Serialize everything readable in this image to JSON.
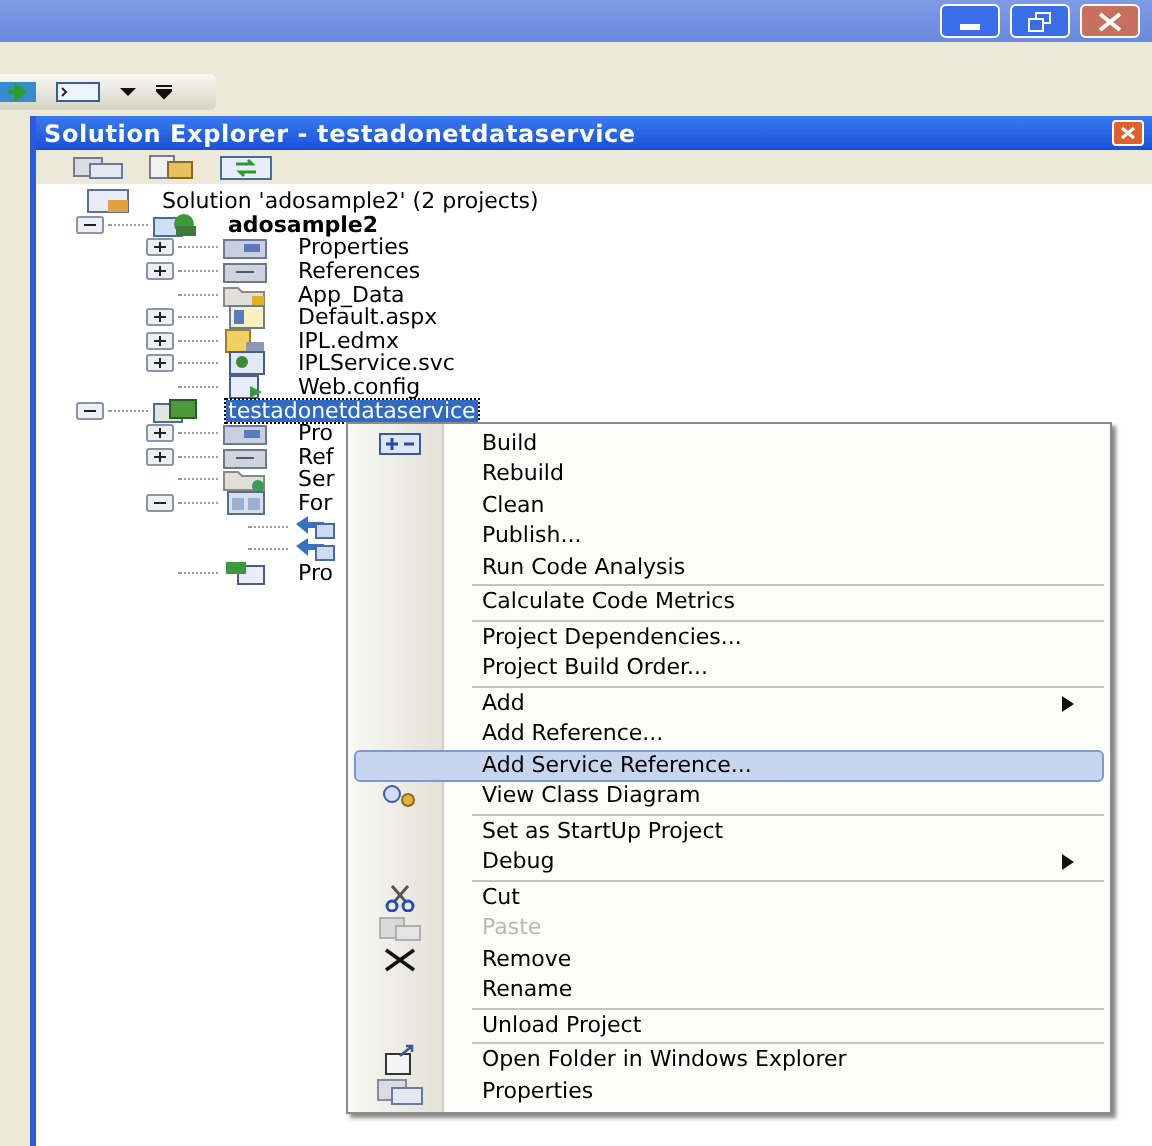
{
  "solution_explorer": {
    "title": "Solution Explorer - testadonetdataservice",
    "tree": [
      {
        "label": "Solution 'adosample2' (2 projects)",
        "kind": "solution",
        "selected": false,
        "children": [
          {
            "label": "adosample2",
            "kind": "web-project",
            "bold": true,
            "expanded": true,
            "selected": false,
            "children": [
              {
                "label": "Properties",
                "kind": "properties",
                "expanded": false,
                "selected": false
              },
              {
                "label": "References",
                "kind": "references",
                "expanded": false,
                "selected": false
              },
              {
                "label": "App_Data",
                "kind": "folder",
                "selected": false
              },
              {
                "label": "Default.aspx",
                "kind": "page",
                "expanded": false,
                "selected": false
              },
              {
                "label": "IPL.edmx",
                "kind": "model",
                "expanded": false,
                "selected": false
              },
              {
                "label": "IPLService.svc",
                "kind": "service",
                "expanded": false,
                "selected": false
              },
              {
                "label": "Web.config",
                "kind": "config",
                "selected": false
              }
            ]
          },
          {
            "label": "testadonetdataservice",
            "kind": "cs-project",
            "bold": false,
            "expanded": true,
            "selected": true,
            "children": [
              {
                "label": "Pro",
                "kind": "properties",
                "expanded": false,
                "selected": false
              },
              {
                "label": "Ref",
                "kind": "references",
                "expanded": false,
                "selected": false
              },
              {
                "label": "Ser",
                "kind": "service-folder",
                "selected": false
              },
              {
                "label": "For",
                "kind": "form",
                "expanded": true,
                "selected": false,
                "children": [
                  {
                    "kind": "form-item"
                  },
                  {
                    "kind": "form-item"
                  }
                ]
              },
              {
                "label": "Pro",
                "kind": "cs-file",
                "selected": false
              }
            ]
          }
        ]
      }
    ]
  },
  "context_menu": {
    "groups": [
      [
        {
          "label": "Build",
          "kind": "build",
          "disabled": false,
          "selected": false,
          "submenu": false
        },
        {
          "label": "Rebuild",
          "kind": "plain",
          "disabled": false,
          "selected": false,
          "submenu": false
        },
        {
          "label": "Clean",
          "kind": "plain",
          "disabled": false,
          "selected": false,
          "submenu": false
        },
        {
          "label": "Publish...",
          "kind": "plain",
          "disabled": false,
          "selected": false,
          "submenu": false
        },
        {
          "label": "Run Code Analysis",
          "kind": "plain",
          "disabled": false,
          "selected": false,
          "submenu": false
        }
      ],
      [
        {
          "label": "Calculate Code Metrics",
          "kind": "plain",
          "disabled": false,
          "selected": false,
          "submenu": false
        }
      ],
      [
        {
          "label": "Project Dependencies...",
          "kind": "plain",
          "disabled": false,
          "selected": false,
          "submenu": false
        },
        {
          "label": "Project Build Order...",
          "kind": "plain",
          "disabled": false,
          "selected": false,
          "submenu": false
        }
      ],
      [
        {
          "label": "Add",
          "kind": "plain",
          "disabled": false,
          "selected": false,
          "submenu": true
        },
        {
          "label": "Add Reference...",
          "kind": "plain",
          "disabled": false,
          "selected": false,
          "submenu": false
        },
        {
          "label": "Add Service Reference...",
          "kind": "plain",
          "disabled": false,
          "selected": true,
          "submenu": false
        },
        {
          "label": "View Class Diagram",
          "kind": "diagram",
          "disabled": false,
          "selected": false,
          "submenu": false
        }
      ],
      [
        {
          "label": "Set as StartUp Project",
          "kind": "plain",
          "disabled": false,
          "selected": false,
          "submenu": false
        },
        {
          "label": "Debug",
          "kind": "plain",
          "disabled": false,
          "selected": false,
          "submenu": true
        }
      ],
      [
        {
          "label": "Cut",
          "kind": "cut",
          "disabled": false,
          "selected": false,
          "submenu": false
        },
        {
          "label": "Paste",
          "kind": "paste",
          "disabled": true,
          "selected": false,
          "submenu": false
        },
        {
          "label": "Remove",
          "kind": "remove",
          "disabled": false,
          "selected": false,
          "submenu": false
        },
        {
          "label": "Rename",
          "kind": "plain",
          "disabled": false,
          "selected": false,
          "submenu": false
        }
      ],
      [
        {
          "label": "Unload Project",
          "kind": "plain",
          "disabled": false,
          "selected": false,
          "submenu": false
        }
      ],
      [
        {
          "label": "Open Folder in Windows Explorer",
          "kind": "open-folder",
          "disabled": false,
          "selected": false,
          "submenu": false
        },
        {
          "label": "Properties",
          "kind": "properties",
          "disabled": false,
          "selected": false,
          "submenu": false
        }
      ]
    ]
  }
}
